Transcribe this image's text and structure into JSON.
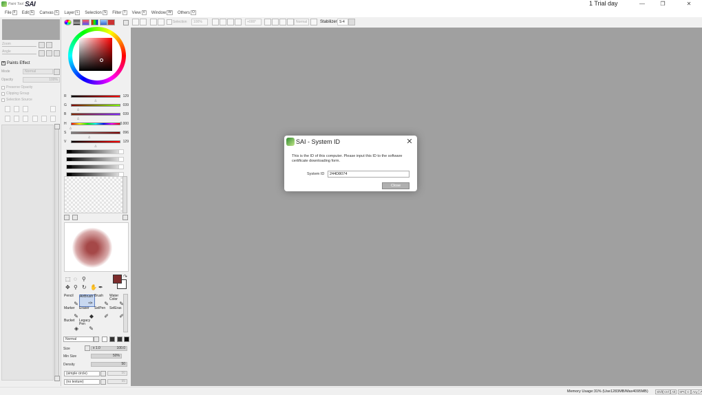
{
  "app": {
    "logo_small": "Paint Tool",
    "logo_big": "SAI",
    "trial": "1 Trial day",
    "window_buttons": [
      "—",
      "❐",
      "✕"
    ]
  },
  "menu": [
    {
      "label": "File",
      "key": "F"
    },
    {
      "label": "Edit",
      "key": "E"
    },
    {
      "label": "Canvas",
      "key": "C"
    },
    {
      "label": "Layer",
      "key": "L"
    },
    {
      "label": "Selection",
      "key": "S"
    },
    {
      "label": "Filter",
      "key": "T"
    },
    {
      "label": "View",
      "key": "V"
    },
    {
      "label": "Window",
      "key": "W"
    },
    {
      "label": "Others",
      "key": "O"
    }
  ],
  "navigator": {
    "zoom_label": "Zoom",
    "angle_label": "Angle"
  },
  "layer_panel": {
    "paints_effect": "Paints Effect",
    "mode_label": "Mode",
    "mode_value": "Normal",
    "opacity_label": "Opacity",
    "opacity_value": "100%",
    "preserve_opacity": "Preserve Opacity",
    "clipping_group": "Clipping Group",
    "selection_source": "Selection Source"
  },
  "color": {
    "sliders": [
      {
        "label": "R",
        "value": "129",
        "position": 0.506,
        "from": "#000000",
        "to": "#ff0000"
      },
      {
        "label": "G",
        "value": "039",
        "position": 0.153,
        "from": "#810000",
        "to": "#81ff00"
      },
      {
        "label": "B",
        "value": "039",
        "position": 0.153,
        "from": "#812700",
        "to": "#8127ff"
      },
      {
        "label": "H",
        "value": "0.000",
        "position": 0.0,
        "from": "hue",
        "to": "hue"
      },
      {
        "label": "S",
        "value": "096",
        "position": 0.376,
        "from": "#818181",
        "to": "#810000"
      },
      {
        "label": "V",
        "value": "129",
        "position": 0.506,
        "from": "#000000",
        "to": "#ff0000"
      }
    ],
    "foreground": "#7d2c2c",
    "background": "#ffffff"
  },
  "toolbar": {
    "selection_label": "Selection",
    "zoom_value": "100%",
    "angle_value": "+000°",
    "blend_value": "Normal",
    "stabilizer_label": "Stabilizer",
    "stabilizer_value": "S-4"
  },
  "brushes": [
    {
      "name": "Pencil",
      "icon": "pencil-icon",
      "glyph": "✎"
    },
    {
      "name": "AirBrush",
      "icon": "airbrush-icon",
      "glyph": "✑",
      "selected": true
    },
    {
      "name": "Brush",
      "icon": "brush-icon",
      "glyph": "✎"
    },
    {
      "name": "Water Color",
      "icon": "watercolor-icon",
      "glyph": "✎"
    },
    {
      "name": "Marker",
      "icon": "marker-icon",
      "glyph": "✎"
    },
    {
      "name": "Eraser",
      "icon": "eraser-icon",
      "glyph": "◆"
    },
    {
      "name": "SelPen",
      "icon": "selpen-icon",
      "glyph": "✐"
    },
    {
      "name": "SelEras",
      "icon": "seleras-icon",
      "glyph": "✐"
    },
    {
      "name": "Bucket",
      "icon": "bucket-icon",
      "glyph": "◈"
    },
    {
      "name": "Legacy Pen",
      "icon": "legacy-pen-icon",
      "glyph": "✎"
    }
  ],
  "brush_props": {
    "blend_mode": "Normal",
    "size_label": "Size",
    "size_mult": "x 1.0",
    "size_value": "100.0",
    "min_size_label": "Min Size",
    "min_size_value": "50%",
    "density_label": "Density",
    "density_value": "50",
    "shape": "(simple circle)",
    "shape_value": "50",
    "texture": "(no texture)",
    "texture_value": "95"
  },
  "dialog": {
    "title": "SAI - System ID",
    "message": "This is the ID of this computer. Please input this ID to the software certificate downloading form.",
    "field_label": "System ID",
    "field_value": "244D8074",
    "button": "Close"
  },
  "status": {
    "memory": "Memory Usage:31% (Use1283MB/Max4095MB)",
    "keys": [
      "Shift",
      "Ctrl",
      "Alt",
      "SPC",
      "⊙",
      "Any",
      "✐"
    ]
  }
}
